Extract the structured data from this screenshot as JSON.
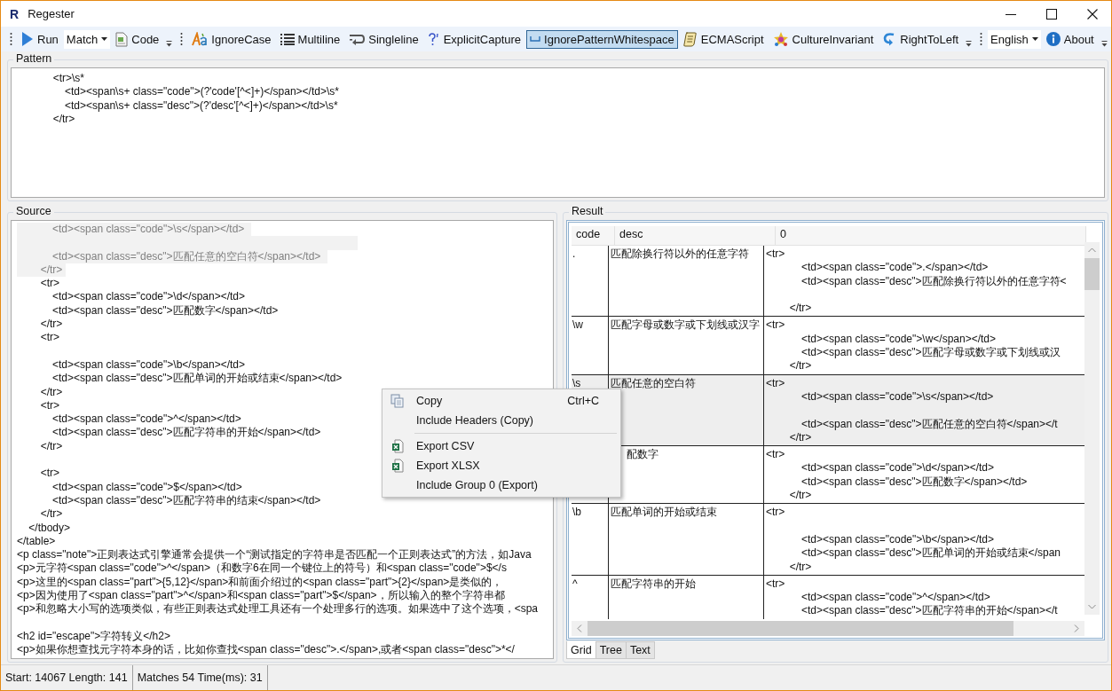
{
  "window": {
    "logo": "R",
    "title": "Regester"
  },
  "toolbar": {
    "run": "Run",
    "mode": "Match",
    "code": "Code",
    "options": [
      {
        "label": "IgnoreCase",
        "checked": false
      },
      {
        "label": "Multiline",
        "checked": false
      },
      {
        "label": "Singleline",
        "checked": false
      },
      {
        "label": "ExplicitCapture",
        "checked": false
      },
      {
        "label": "IgnorePatternWhitespace",
        "checked": true
      },
      {
        "label": "ECMAScript",
        "checked": false
      },
      {
        "label": "CultureInvariant",
        "checked": false
      },
      {
        "label": "RightToLeft",
        "checked": false
      }
    ],
    "language": "English",
    "about": "About"
  },
  "pattern": {
    "label": "Pattern",
    "lines": [
      "        <tr>\\s*",
      "            <td><span\\s+ class=\"code\">(?'code'[^<]+)</span></td>\\s*",
      "            <td><span\\s+ class=\"desc\">(?'desc'[^<]+)</span></td>\\s*",
      "        </tr>"
    ]
  },
  "source": {
    "label": "Source",
    "lines": [
      {
        "text": "            <td><span class=\"code\">\\s</span></td> ",
        "highlighted": true
      },
      {
        "highlighted": true
      },
      {
        "text": "            <td><span class=\"desc\">匹配任意的空白符</span></td> ",
        "highlighted": true
      },
      {
        "text": "        </tr>",
        "highlighted": true
      },
      {
        "text": "        <tr>",
        "highlighted": false
      },
      {
        "text": "            <td><span class=\"code\">\\d</span></td>",
        "highlighted": false
      },
      {
        "text": "            <td><span class=\"desc\">匹配数字</span></td>",
        "highlighted": false
      },
      {
        "text": "        </tr>",
        "highlighted": false
      },
      {
        "text": "        <tr>",
        "highlighted": false
      },
      {
        "highlighted": false
      },
      {
        "text": "            <td><span class=\"code\">\\b</span></td>",
        "highlighted": false
      },
      {
        "text": "            <td><span class=\"desc\">匹配单词的开始或结束</span></td>",
        "highlighted": false
      },
      {
        "text": "        </tr>",
        "highlighted": false
      },
      {
        "text": "        <tr>",
        "highlighted": false
      },
      {
        "text": "            <td><span class=\"code\">^</span></td>",
        "highlighted": false
      },
      {
        "text": "            <td><span class=\"desc\">匹配字符串的开始</span></td>",
        "highlighted": false
      },
      {
        "text": "        </tr>",
        "highlighted": false
      },
      {
        "highlighted": false
      },
      {
        "text": "        <tr>",
        "highlighted": false
      },
      {
        "text": "            <td><span class=\"code\">$</span></td>",
        "highlighted": false
      },
      {
        "text": "            <td><span class=\"desc\">匹配字符串的结束</span></td>",
        "highlighted": false
      },
      {
        "text": "        </tr>",
        "highlighted": false
      },
      {
        "text": "    </tbody>",
        "highlighted": false
      },
      {
        "text": "</table>",
        "highlighted": false
      },
      {
        "text": "<p class=\"note\">正则表达式引擎通常会提供一个“测试指定的字符串是否匹配一个正则表达式”的方法，如Java",
        "highlighted": false
      },
      {
        "text": "<p>元字符<span class=\"code\">^</span>（和数字6在同一个键位上的符号）和<span class=\"code\">$</s",
        "highlighted": false
      },
      {
        "text": "<p>这里的<span class=\"part\">{5,12}</span>和前面介绍过的<span class=\"part\">{2}</span>是类似的，",
        "highlighted": false
      },
      {
        "text": "<p>因为使用了<span class=\"part\">^</span>和<span class=\"part\">$</span>，所以输入的整个字符串都",
        "highlighted": false
      },
      {
        "text": "<p>和忽略大小写的选项类似，有些正则表达式处理工具还有一个处理多行的选项。如果选中了这个选项，<spa",
        "highlighted": false
      },
      {
        "highlighted": false
      },
      {
        "text": "<h2 id=\"escape\">字符转义</h2>",
        "highlighted": false
      },
      {
        "text": "<p>如果你想查找元字符本身的话，比如你查找<span class=\"desc\">.</span>,或者<span class=\"desc\">*</",
        "highlighted": false
      }
    ]
  },
  "result": {
    "label": "Result",
    "columns": [
      "code",
      "desc",
      "0"
    ],
    "rows": [
      {
        "code": ".",
        "desc": "匹配除换行符以外的任意字符",
        "value": "<tr>\n            <td><span class=\"code\">.</span></td>\n            <td><span class=\"desc\">匹配除换行符以外的任意字符<\n\n        </tr>",
        "selected": false
      },
      {
        "code": "\\w",
        "desc": "匹配字母或数字或下划线或汉字",
        "value": "<tr>\n            <td><span class=\"code\">\\w</span></td>\n            <td><span class=\"desc\">匹配字母或数字或下划线或汉\n        </tr>",
        "selected": false
      },
      {
        "code": "\\s",
        "desc": "匹配任意的空白符",
        "value": "<tr>\n            <td><span class=\"code\">\\s</span></td>\n\n            <td><span class=\"desc\">匹配任意的空白符</span></t\n        </tr>",
        "selected": true
      },
      {
        "desc": "配数字",
        "obscured": true,
        "value": "<tr>\n            <td><span class=\"code\">\\d</span></td>\n            <td><span class=\"desc\">匹配数字</span></td>\n        </tr>",
        "selected": false
      },
      {
        "code": "\\b",
        "desc": "匹配单词的开始或结束",
        "value": "<tr>\n\n            <td><span class=\"code\">\\b</span></td>\n            <td><span class=\"desc\">匹配单词的开始或结束</span\n        </tr>",
        "selected": false
      },
      {
        "code": "^",
        "desc": "匹配字符串的开始",
        "value": "<tr>\n            <td><span class=\"code\">^</span></td>\n            <td><span class=\"desc\">匹配字符串的开始</span></t",
        "selected": false
      }
    ],
    "tabs": [
      {
        "label": "Grid",
        "selected": true
      },
      {
        "label": "Tree",
        "selected": false
      },
      {
        "label": "Text",
        "selected": false
      }
    ]
  },
  "context_menu": {
    "groups": [
      [
        {
          "kind": "copy",
          "label": "Copy",
          "shortcut": "Ctrl+C"
        },
        {
          "kind": "text",
          "label": "Include Headers (Copy)"
        }
      ],
      [
        {
          "kind": "sheet",
          "label": "Export CSV"
        },
        {
          "kind": "sheet",
          "label": "Export XLSX"
        },
        {
          "kind": "text",
          "label": "Include Group 0 (Export)"
        }
      ]
    ]
  },
  "status_bar": [
    "Start: 14067 Length: 141",
    "Matches 54 Time(ms): 31"
  ]
}
